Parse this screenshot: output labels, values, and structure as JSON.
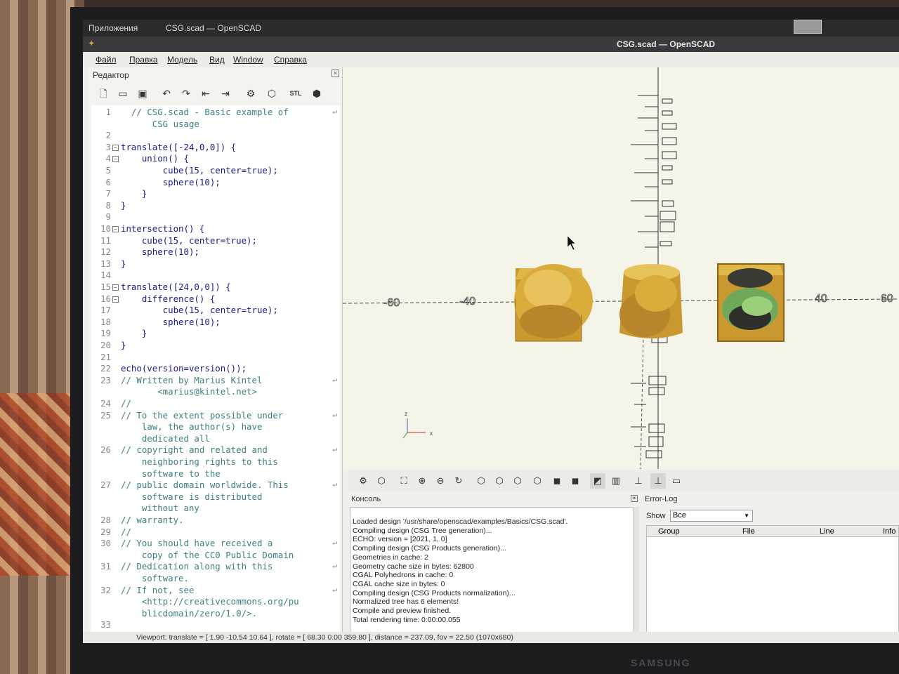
{
  "taskbar": {
    "apps_label": "Приложения",
    "window_title": "CSG.scad — OpenSCAD"
  },
  "window": {
    "title": "CSG.scad — OpenSCAD"
  },
  "menu": [
    "Файл",
    "Правка",
    "Модель",
    "Вид",
    "Window",
    "Справка"
  ],
  "editor": {
    "title": "Редактор",
    "stl_label": "STL",
    "lines": [
      {
        "n": "1",
        "text": "  // CSG.scad - Basic example of",
        "cls": "cm",
        "wrap": true
      },
      {
        "n": "",
        "text": "      CSG usage",
        "cls": "cm"
      },
      {
        "n": "2",
        "text": ""
      },
      {
        "n": "3",
        "text": "translate([-24,0,0]) {",
        "fold": true
      },
      {
        "n": "4",
        "text": "    union() {",
        "fold": true
      },
      {
        "n": "5",
        "text": "        cube(15, center=true);"
      },
      {
        "n": "6",
        "text": "        sphere(10);"
      },
      {
        "n": "7",
        "text": "    }"
      },
      {
        "n": "8",
        "text": "}"
      },
      {
        "n": "9",
        "text": ""
      },
      {
        "n": "10",
        "text": "intersection() {",
        "fold": true
      },
      {
        "n": "11",
        "text": "    cube(15, center=true);"
      },
      {
        "n": "12",
        "text": "    sphere(10);"
      },
      {
        "n": "13",
        "text": "}"
      },
      {
        "n": "14",
        "text": ""
      },
      {
        "n": "15",
        "text": "translate([24,0,0]) {",
        "fold": true
      },
      {
        "n": "16",
        "text": "    difference() {",
        "fold": true
      },
      {
        "n": "17",
        "text": "        cube(15, center=true);"
      },
      {
        "n": "18",
        "text": "        sphere(10);"
      },
      {
        "n": "19",
        "text": "    }"
      },
      {
        "n": "20",
        "text": "}"
      },
      {
        "n": "21",
        "text": ""
      },
      {
        "n": "22",
        "text": "echo(version=version());"
      },
      {
        "n": "23",
        "text": "// Written by Marius Kintel",
        "cls": "cm",
        "wrap": true
      },
      {
        "n": "",
        "text": "       <marius@kintel.net>",
        "cls": "cm"
      },
      {
        "n": "24",
        "text": "//",
        "cls": "cm"
      },
      {
        "n": "25",
        "text": "// To the extent possible under",
        "cls": "cm",
        "wrap": true
      },
      {
        "n": "",
        "text": "    law, the author(s) have",
        "cls": "cm"
      },
      {
        "n": "",
        "text": "    dedicated all",
        "cls": "cm"
      },
      {
        "n": "26",
        "text": "// copyright and related and",
        "cls": "cm",
        "wrap": true
      },
      {
        "n": "",
        "text": "    neighboring rights to this",
        "cls": "cm"
      },
      {
        "n": "",
        "text": "    software to the",
        "cls": "cm"
      },
      {
        "n": "27",
        "text": "// public domain worldwide. This",
        "cls": "cm",
        "wrap": true
      },
      {
        "n": "",
        "text": "    software is distributed",
        "cls": "cm"
      },
      {
        "n": "",
        "text": "    without any",
        "cls": "cm"
      },
      {
        "n": "28",
        "text": "// warranty.",
        "cls": "cm"
      },
      {
        "n": "29",
        "text": "//",
        "cls": "cm"
      },
      {
        "n": "30",
        "text": "// You should have received a",
        "cls": "cm",
        "wrap": true
      },
      {
        "n": "",
        "text": "    copy of the CC0 Public Domain",
        "cls": "cm"
      },
      {
        "n": "31",
        "text": "// Dedication along with this",
        "cls": "cm",
        "wrap": true
      },
      {
        "n": "",
        "text": "    software.",
        "cls": "cm"
      },
      {
        "n": "32",
        "text": "// If not, see",
        "cls": "cm",
        "wrap": true
      },
      {
        "n": "",
        "text": "    <http://creativecommons.org/pu",
        "cls": "cm"
      },
      {
        "n": "",
        "text": "    blicdomain/zero/1.0/>.",
        "cls": "cm"
      },
      {
        "n": "33",
        "text": ""
      }
    ]
  },
  "viewport": {
    "axis_labels": [
      "-60",
      "-40",
      "40",
      "60"
    ],
    "axes_gizmo": {
      "z": "z",
      "x": "x"
    },
    "model_color": "#d4a93a",
    "background_color": "#f5f4e8"
  },
  "console": {
    "title": "Консоль",
    "lines": [
      "Loaded design '/usr/share/openscad/examples/Basics/CSG.scad'.",
      "Compiling design (CSG Tree generation)...",
      "ECHO: version = [2021, 1, 0]",
      "Compiling design (CSG Products generation)...",
      "Geometries in cache: 2",
      "Geometry cache size in bytes: 62800",
      "CGAL Polyhedrons in cache: 0",
      "CGAL cache size in bytes: 0",
      "Compiling design (CSG Products normalization)...",
      "Normalized tree has 6 elements!",
      "Compile and preview finished.",
      "Total rendering time: 0:00:00.055"
    ]
  },
  "errorlog": {
    "title": "Error-Log",
    "show_label": "Show",
    "show_value": "Все",
    "columns": [
      "Group",
      "File",
      "Line",
      "Info"
    ]
  },
  "statusbar": {
    "text": "Viewport: translate = [ 1.90 -10.54 10.64 ], rotate = [ 68.30 0.00 359.80 ], distance = 237.09, fov = 22.50 (1070x680)"
  },
  "bezel": {
    "brand": "SAMSUNG"
  }
}
